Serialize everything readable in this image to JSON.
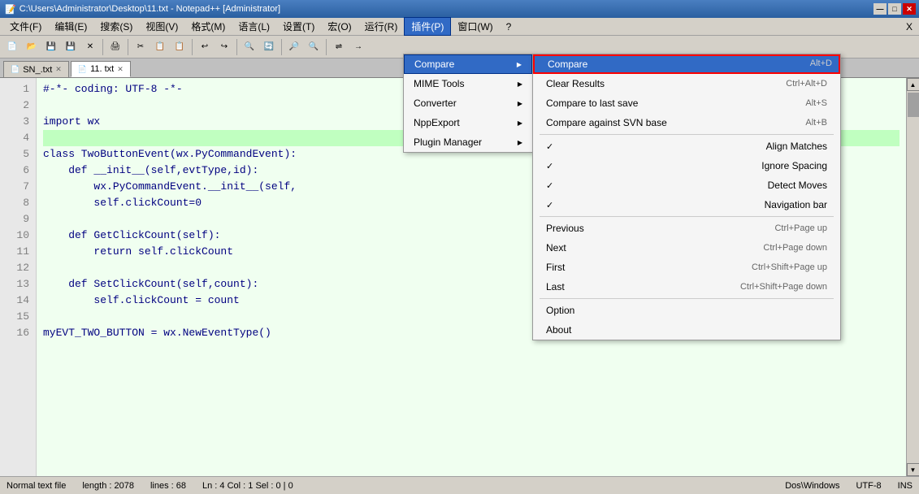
{
  "titleBar": {
    "title": "C:\\Users\\Administrator\\Desktop\\11.txt - Notepad++ [Administrator]",
    "minimize": "—",
    "maximize": "□",
    "close": "✕"
  },
  "menuBar": {
    "items": [
      {
        "label": "文件(F)"
      },
      {
        "label": "编辑(E)"
      },
      {
        "label": "搜索(S)"
      },
      {
        "label": "视图(V)"
      },
      {
        "label": "格式(M)"
      },
      {
        "label": "语言(L)"
      },
      {
        "label": "设置(T)"
      },
      {
        "label": "宏(O)"
      },
      {
        "label": "运行(R)"
      },
      {
        "label": "插件(P)",
        "active": true
      },
      {
        "label": "窗口(W)"
      },
      {
        "label": "?"
      }
    ]
  },
  "tabs": [
    {
      "label": "SN_.txt",
      "active": false
    },
    {
      "label": "11. txt",
      "active": true
    }
  ],
  "codeLines": [
    {
      "num": 1,
      "code": "#-*- coding: UTF-8 -*-"
    },
    {
      "num": 2,
      "code": ""
    },
    {
      "num": 3,
      "code": "import wx"
    },
    {
      "num": 4,
      "code": ""
    },
    {
      "num": 5,
      "code": "class TwoButtonEvent(wx.PyCommandEvent):"
    },
    {
      "num": 6,
      "code": "    def __init__(self,evtType,id):"
    },
    {
      "num": 7,
      "code": "        wx.PyCommandEvent.__init__(self,"
    },
    {
      "num": 8,
      "code": "        self.clickCount=0"
    },
    {
      "num": 9,
      "code": ""
    },
    {
      "num": 10,
      "code": "    def GetClickCount(self):"
    },
    {
      "num": 11,
      "code": "        return self.clickCount"
    },
    {
      "num": 12,
      "code": ""
    },
    {
      "num": 13,
      "code": "    def SetClickCount(self,count):"
    },
    {
      "num": 14,
      "code": "        self.clickCount = count"
    },
    {
      "num": 15,
      "code": ""
    },
    {
      "num": 16,
      "code": "myEVT_TWO_BUTTON = wx.NewEventType()"
    }
  ],
  "pluginMenu": {
    "items": [
      {
        "label": "Compare",
        "hasSubmenu": true,
        "active": true
      },
      {
        "label": "MIME Tools",
        "hasSubmenu": true
      },
      {
        "label": "Converter",
        "hasSubmenu": true
      },
      {
        "label": "NppExport",
        "hasSubmenu": true
      },
      {
        "label": "Plugin Manager",
        "hasSubmenu": true
      }
    ]
  },
  "compareMenu": {
    "topItem": {
      "label": "Compare",
      "shortcut": "Alt+D"
    },
    "items": [
      {
        "label": "Clear Results",
        "shortcut": "Ctrl+Alt+D"
      },
      {
        "label": "Compare to last save",
        "shortcut": "Alt+S"
      },
      {
        "label": "Compare against SVN base",
        "shortcut": "Alt+B"
      },
      {
        "divider": true
      },
      {
        "label": "Align Matches",
        "checked": true,
        "shortcut": ""
      },
      {
        "label": "Ignore Spacing",
        "checked": true,
        "shortcut": ""
      },
      {
        "label": "Detect Moves",
        "checked": true,
        "shortcut": ""
      },
      {
        "label": "Navigation bar",
        "checked": true,
        "shortcut": ""
      },
      {
        "divider": true
      },
      {
        "label": "Previous",
        "shortcut": "Ctrl+Page up"
      },
      {
        "label": "Next",
        "shortcut": "Ctrl+Page down"
      },
      {
        "label": "First",
        "shortcut": "Ctrl+Shift+Page up"
      },
      {
        "label": "Last",
        "shortcut": "Ctrl+Shift+Page down"
      },
      {
        "divider": true
      },
      {
        "label": "Option",
        "shortcut": ""
      },
      {
        "label": "About",
        "shortcut": ""
      }
    ]
  },
  "statusBar": {
    "fileType": "Normal text file",
    "length": "length : 2078",
    "lines": "lines : 68",
    "position": "Ln : 4   Col : 1   Sel : 0 | 0",
    "lineEnding": "Dos\\Windows",
    "encoding": "UTF-8",
    "mode": "INS"
  }
}
